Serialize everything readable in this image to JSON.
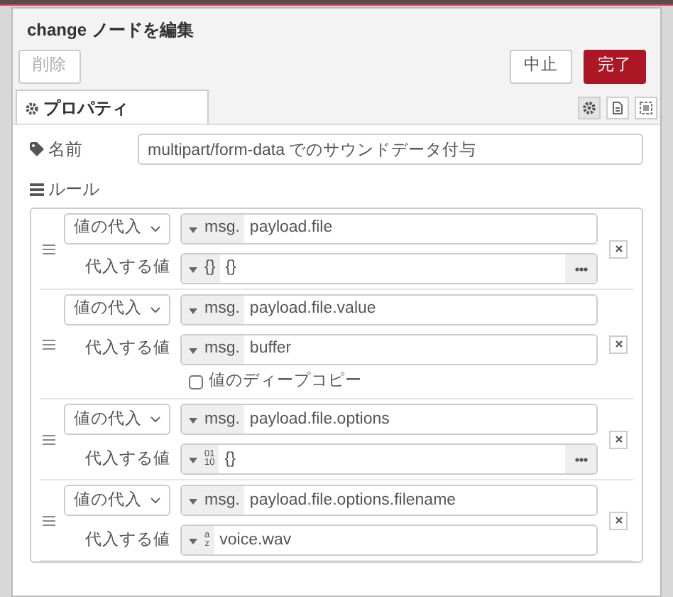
{
  "dialog": {
    "title": "change ノードを編集"
  },
  "buttons": [
    {
      "label": "削除",
      "kind": "delete",
      "disabled": true
    },
    {
      "label": "中止",
      "kind": "cancel",
      "disabled": false
    },
    {
      "label": "完了",
      "kind": "done",
      "disabled": false
    }
  ],
  "tabs": [
    {
      "label": "プロパティ",
      "selected": true
    }
  ],
  "tab_tools": [
    {
      "kind": "gear",
      "selected": true
    },
    {
      "kind": "document",
      "selected": false
    },
    {
      "kind": "frame",
      "selected": false
    }
  ],
  "name_field": {
    "label": "名前",
    "value": "multipart/form-data でのサウンドデータ付与"
  },
  "rules_label": "ルール",
  "rules": [
    {
      "action": "値の代入",
      "target_type": {
        "kind": "msg",
        "label": "msg."
      },
      "target": "payload.file",
      "value_label": "代入する値",
      "value_type": {
        "kind": "json",
        "label": "{}"
      },
      "value": "{}",
      "expandable": true
    },
    {
      "action": "値の代入",
      "target_type": {
        "kind": "msg",
        "label": "msg."
      },
      "target": "payload.file.value",
      "value_label": "代入する値",
      "value_type": {
        "kind": "msg",
        "label": "msg."
      },
      "value": "buffer",
      "expandable": false,
      "deep_copy": {
        "label": "値のディープコピー",
        "checked": false
      }
    },
    {
      "action": "値の代入",
      "target_type": {
        "kind": "msg",
        "label": "msg."
      },
      "target": "payload.file.options",
      "value_label": "代入する値",
      "value_type": {
        "kind": "bin",
        "lines": [
          "01",
          "10"
        ]
      },
      "value": "{}",
      "expandable": true
    },
    {
      "action": "値の代入",
      "target_type": {
        "kind": "msg",
        "label": "msg."
      },
      "target": "payload.file.options.filename",
      "value_label": "代入する値",
      "value_type": {
        "kind": "str",
        "lines": [
          "a",
          "z"
        ]
      },
      "value": "voice.wav",
      "expandable": false
    }
  ]
}
